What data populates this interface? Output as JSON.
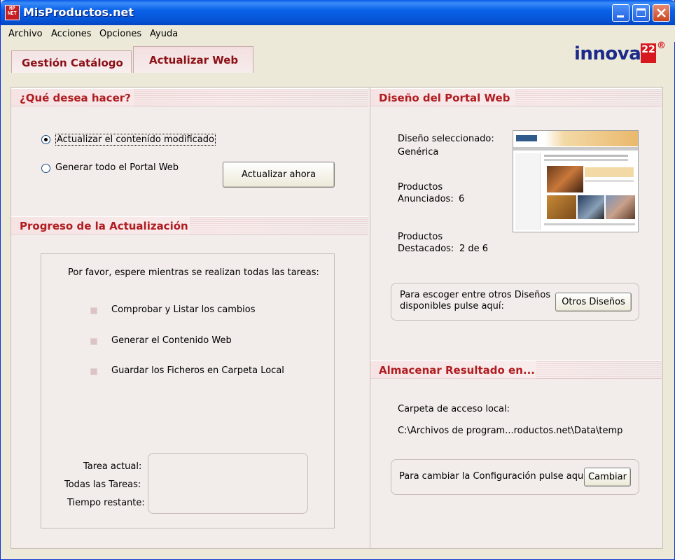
{
  "window": {
    "title": "MisProductos.net",
    "icon_text": "MP NET"
  },
  "menu": [
    "Archivo",
    "Acciones",
    "Opciones",
    "Ayuda"
  ],
  "tabs": [
    {
      "label": "Gestión Catálogo",
      "active": false
    },
    {
      "label": "Actualizar Web",
      "active": true
    }
  ],
  "logo": {
    "text": "innova",
    "badge": "22",
    "reg": "®"
  },
  "que_desea": {
    "title": "¿Qué desea hacer?",
    "option1": "Actualizar el contenido modificado",
    "option2": "Generar todo el Portal Web",
    "selected": "option1",
    "button": "Actualizar ahora"
  },
  "progreso": {
    "title": "Progreso de la Actualización",
    "wait_text": "Por favor, espere mientras se realizan todas las tareas:",
    "tasks": [
      "Comprobar y Listar los cambios",
      "Generar el Contenido Web",
      "Guardar los Ficheros en Carpeta Local"
    ],
    "labels": {
      "current": "Tarea actual:",
      "all": "Todas las Tareas:",
      "remaining": "Tiempo restante:"
    }
  },
  "diseno": {
    "title": "Diseño del Portal Web",
    "selected_label": "Diseño seleccionado:",
    "selected_value": "Genérica",
    "anunciados_l1": "Productos",
    "anunciados_l2": "Anunciados:",
    "anunciados_value": "6",
    "destacados_l1": "Productos",
    "destacados_l2": "Destacados:",
    "destacados_value": "2 de 6",
    "otros_text_l1": "Para escoger entre otros Diseños",
    "otros_text_l2": "disponibles pulse aquí:",
    "otros_button": "Otros Diseños"
  },
  "almacenar": {
    "title": "Almacenar Resultado en...",
    "folder_label": "Carpeta de acceso local:",
    "folder_path": "C:\\Archivos de program...roductos.net\\Data\\temp",
    "config_text": "Para cambiar la Configuración pulse aquí:",
    "config_button": "Cambiar"
  },
  "colors": {
    "accent": "#b01c20",
    "panel": "#f2ecea",
    "titlebar": "#0a5ae8"
  }
}
